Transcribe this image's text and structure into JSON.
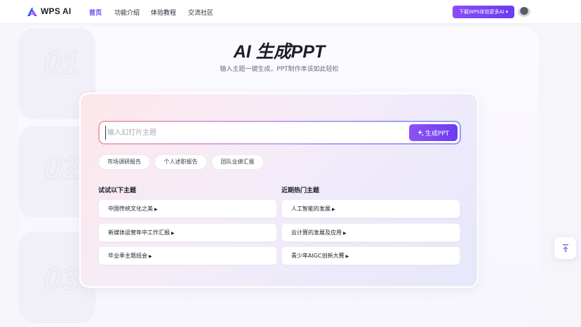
{
  "header": {
    "brand": "WPS AI",
    "nav": [
      {
        "label": "首页",
        "active": true
      },
      {
        "label": "功能介绍",
        "active": false
      },
      {
        "label": "体验教程",
        "active": false
      },
      {
        "label": "交流社区",
        "active": false
      }
    ],
    "download_label": "下载WPS体验更多AI ▾"
  },
  "background": {
    "steps": [
      "01",
      "02",
      "03"
    ]
  },
  "hero": {
    "title": "AI 生成PPT",
    "subtitle": "输入主题一键生成，PPT制作本该如此轻松"
  },
  "generator": {
    "input_placeholder": "输入幻灯片主题",
    "input_value": "",
    "generate_label": "生成PPT",
    "chips": [
      "市场调研报告",
      "个人述职报告",
      "团队业绩汇报"
    ]
  },
  "suggestions": {
    "left_title": "试试以下主题",
    "left_items": [
      "中国传统文化之美",
      "新媒体运营年中工作汇报",
      "毕业季主题班会"
    ],
    "right_title": "近期热门主题",
    "right_items": [
      "人工智能的发展",
      "云计算的发展及应用",
      "青少年AIGC创新大赛"
    ],
    "arrow": "▶"
  },
  "colors": {
    "accent": "#6c3cef",
    "accent_light": "#8c52f5",
    "nav_active": "#5b3ff0"
  },
  "icons": {
    "logo": "wps-ai-logo-icon",
    "sparkle": "sparkle-icon",
    "back_to_top": "back-to-top-icon"
  }
}
